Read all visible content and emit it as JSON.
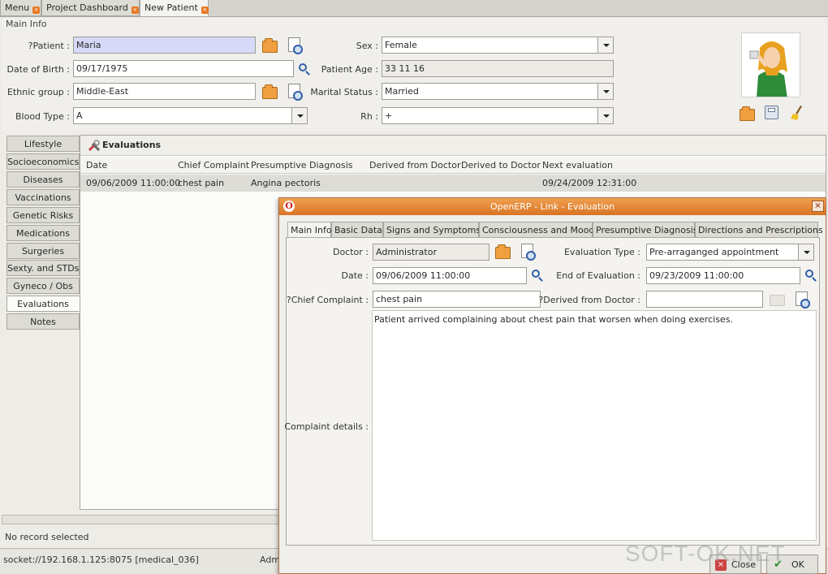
{
  "tabs": [
    {
      "label": "Menu"
    },
    {
      "label": "Project Dashboard"
    },
    {
      "label": "New Patient"
    }
  ],
  "main_info": {
    "section_label": "Main Info",
    "patient_label": "?Patient :",
    "patient_value": "Maria",
    "sex_label": "Sex :",
    "sex_value": "Female",
    "dob_label": "Date of Birth :",
    "dob_value": "09/17/1975",
    "age_label": "Patient Age :",
    "age_value": "33 11 16",
    "ethnic_label": "Ethnic group :",
    "ethnic_value": "Middle-East",
    "marital_label": "Marital Status :",
    "marital_value": "Married",
    "blood_label": "Blood Type :",
    "blood_value": "A",
    "rh_label": "Rh :",
    "rh_value": "+"
  },
  "side_tabs": [
    "Lifestyle",
    "Socioeconomics",
    "Diseases",
    "Vaccinations",
    "Genetic Risks",
    "Medications",
    "Surgeries",
    "Sexty. and STDs",
    "Gyneco / Obs",
    "Evaluations",
    "Notes"
  ],
  "evaluations": {
    "title": "Evaluations",
    "columns": [
      "Date",
      "Chief Complaint",
      "Presumptive Diagnosis",
      "Derived from Doctor",
      "Derived to Doctor",
      "Next evaluation"
    ],
    "rows": [
      {
        "date": "09/06/2009 11:00:00",
        "chief_complaint": "chest pain",
        "diagnosis": "Angina pectoris",
        "derived_from": "",
        "derived_to": "",
        "next_evaluation": "09/24/2009 12:31:00"
      }
    ]
  },
  "status": {
    "no_record": "No record selected",
    "socket": "socket://192.168.1.125:8075 [medical_036]",
    "user_fragment": "Adm"
  },
  "dialog": {
    "title": "OpenERP - Link - Evaluation",
    "tabs": [
      "Main Info",
      "Basic Data",
      "Signs and Symptoms",
      "Consciousness and Mood",
      "Presumptive Diagnosis",
      "Directions and Prescriptions"
    ],
    "doctor_label": "Doctor :",
    "doctor_value": "Administrator",
    "eval_type_label": "Evaluation Type :",
    "eval_type_value": "Pre-arraganged appointment",
    "date_label": "Date :",
    "date_value": "09/06/2009  11:00:00",
    "end_label": "End of Evaluation :",
    "end_value": "09/23/2009  11:00:00",
    "complaint_label": "?Chief Complaint :",
    "complaint_value": "chest pain",
    "derived_label": "?Derived from Doctor :",
    "derived_value": "",
    "details_label": "Complaint details :",
    "details_value": "Patient arrived complaining about chest pain that worsen when doing exercises.",
    "close_label": "Close",
    "ok_label": "OK"
  },
  "watermark": "SOFT-OK.NET",
  "colors": {
    "dialog_title": "#e0802a",
    "required_field": "#d6d9f7",
    "tab_close": "#e87722"
  },
  "icons": [
    "tab-close-icon",
    "folder-open-icon",
    "search-document-icon",
    "search-icon",
    "patient-avatar",
    "print-icon",
    "save-icon",
    "clean-icon",
    "tools-icon",
    "openerp-logo-icon"
  ]
}
